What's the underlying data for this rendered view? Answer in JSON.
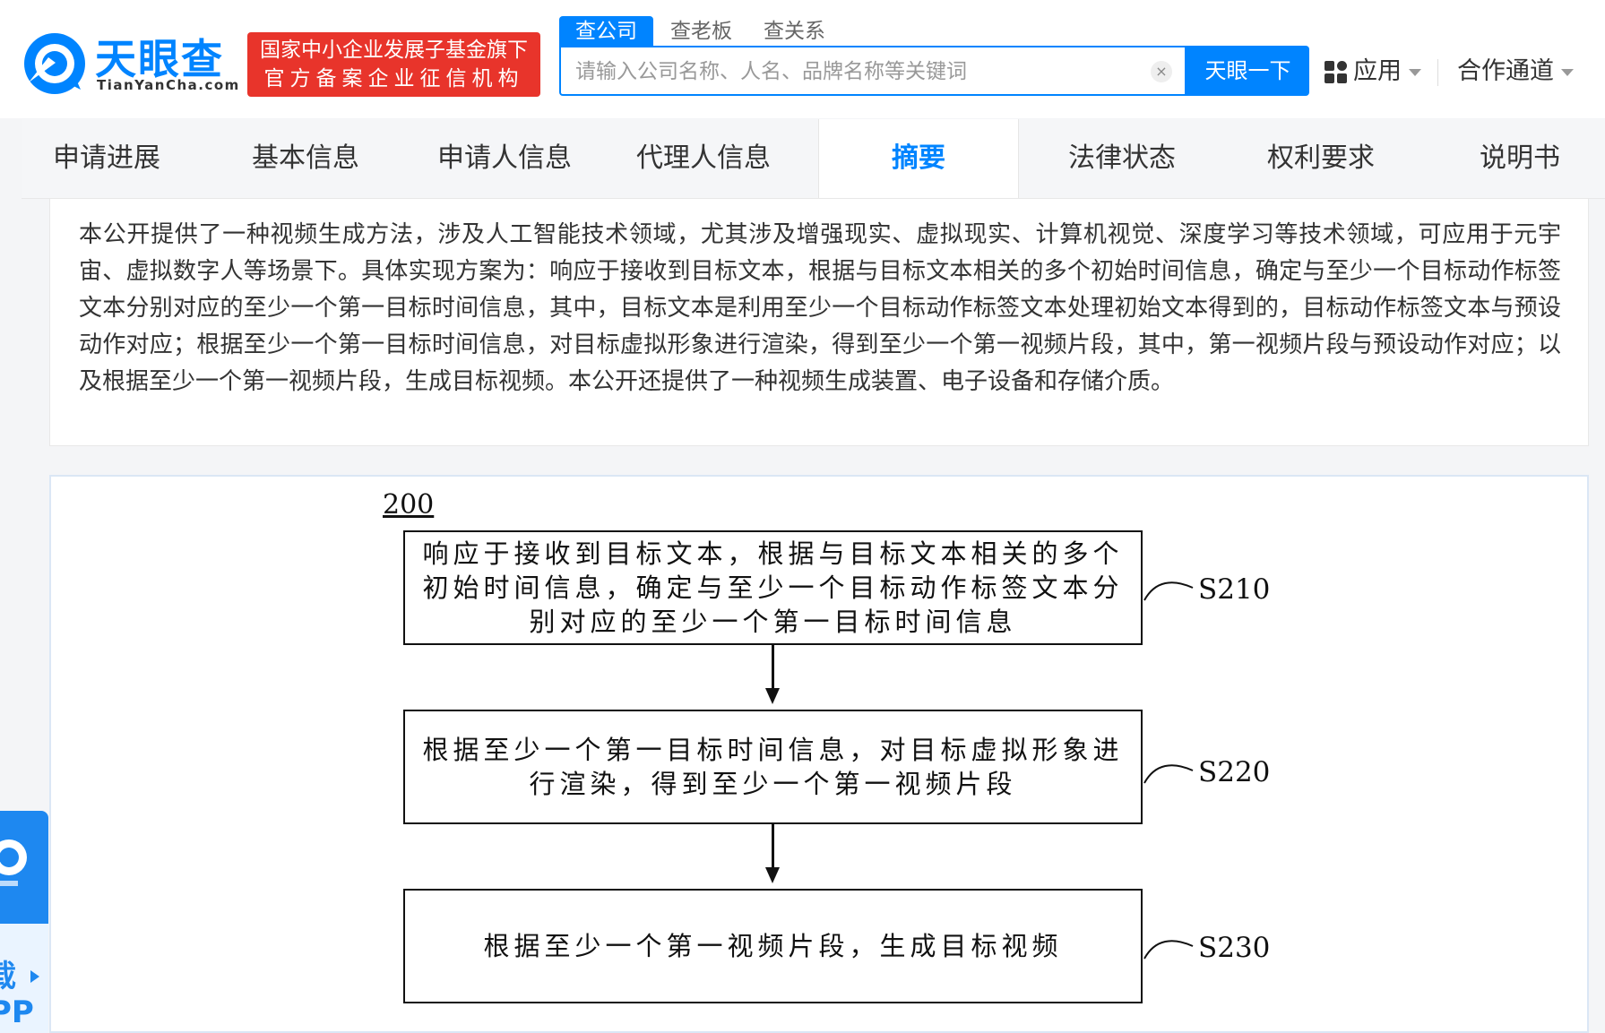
{
  "brand": {
    "name_cn": "天眼查",
    "name_en": "TianYanCha.com",
    "badge_line1": "国家中小企业发展子基金旗下",
    "badge_line2": "官方备案企业征信机构",
    "color": "#0084ff"
  },
  "search": {
    "tabs": [
      "查公司",
      "查老板",
      "查关系"
    ],
    "active_tab": "查公司",
    "placeholder": "请输入公司名称、人名、品牌名称等关键词",
    "value": "",
    "button_label": "天眼一下"
  },
  "header_links": {
    "apps_label": "应用",
    "cooperation_label": "合作通道"
  },
  "nav": {
    "tabs": [
      "申请进展",
      "基本信息",
      "申请人信息",
      "代理人信息",
      "摘要",
      "法律状态",
      "权利要求",
      "说明书"
    ],
    "active": "摘要"
  },
  "abstract": {
    "text": "本公开提供了一种视频生成方法，涉及人工智能技术领域，尤其涉及增强现实、虚拟现实、计算机视觉、深度学习等技术领域，可应用于元宇宙、虚拟数字人等场景下。具体实现方案为：响应于接收到目标文本，根据与目标文本相关的多个初始时间信息，确定与至少一个目标动作标签文本分别对应的至少一个第一目标时间信息，其中，目标文本是利用至少一个目标动作标签文本处理初始文本得到的，目标动作标签文本与预设动作对应；根据至少一个第一目标时间信息，对目标虚拟形象进行渲染，得到至少一个第一视频片段，其中，第一视频片段与预设动作对应；以及根据至少一个第一视频片段，生成目标视频。本公开还提供了一种视频生成装置、电子设备和存储介质。"
  },
  "figure": {
    "number": "200",
    "steps": [
      {
        "label": "S210",
        "text": "响应于接收到目标文本，根据与目标文本相关的多个初始时间信息，确定与至少一个目标动作标签文本分别对应的至少一个第一目标时间信息"
      },
      {
        "label": "S220",
        "text": "根据至少一个第一目标时间信息，对目标虚拟形象进行渲染，得到至少一个第一视频片段"
      },
      {
        "label": "S230",
        "text": "根据至少一个第一视频片段，生成目标视频"
      }
    ]
  },
  "float_widget": {
    "line1": "载",
    "line2": "PP"
  }
}
